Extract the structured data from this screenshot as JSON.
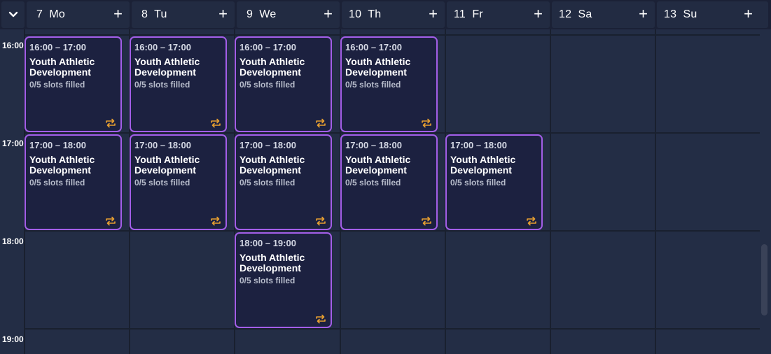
{
  "header": {
    "collapse_icon": "chevron-down-icon",
    "add_icon": "plus-icon",
    "days": [
      {
        "num": "7",
        "name": "Mo"
      },
      {
        "num": "8",
        "name": "Tu"
      },
      {
        "num": "9",
        "name": "We"
      },
      {
        "num": "10",
        "name": "Th"
      },
      {
        "num": "11",
        "name": "Fr"
      },
      {
        "num": "12",
        "name": "Sa"
      },
      {
        "num": "13",
        "name": "Su"
      }
    ]
  },
  "times": [
    "16:00",
    "17:00",
    "18:00",
    "19:00"
  ],
  "events": [
    {
      "day": 0,
      "time": "16:00 – 17:00",
      "title": "Youth Athletic Development",
      "slots": "0/5 slots filled"
    },
    {
      "day": 1,
      "time": "16:00 – 17:00",
      "title": "Youth Athletic Development",
      "slots": "0/5 slots filled"
    },
    {
      "day": 2,
      "time": "16:00 – 17:00",
      "title": "Youth Athletic Development",
      "slots": "0/5 slots filled"
    },
    {
      "day": 3,
      "time": "16:00 – 17:00",
      "title": "Youth Athletic Development",
      "slots": "0/5 slots filled"
    },
    {
      "day": 0,
      "time": "17:00 – 18:00",
      "title": "Youth Athletic Development",
      "slots": "0/5 slots filled"
    },
    {
      "day": 1,
      "time": "17:00 – 18:00",
      "title": "Youth Athletic Development",
      "slots": "0/5 slots filled"
    },
    {
      "day": 2,
      "time": "17:00 – 18:00",
      "title": "Youth Athletic Development",
      "slots": "0/5 slots filled"
    },
    {
      "day": 3,
      "time": "17:00 – 18:00",
      "title": "Youth Athletic Development",
      "slots": "0/5 slots filled"
    },
    {
      "day": 4,
      "time": "17:00 – 18:00",
      "title": "Youth Athletic Development",
      "slots": "0/5 slots filled"
    },
    {
      "day": 2,
      "time": "18:00 – 19:00",
      "title": "Youth Athletic Development",
      "slots": "0/5 slots filled"
    }
  ],
  "event_icon": "repeat-icon",
  "colors": {
    "event_border": "#a35ee8",
    "event_bg": "#1c2140",
    "repeat_icon": "#e8a030",
    "grid_bg": "#232d45"
  }
}
